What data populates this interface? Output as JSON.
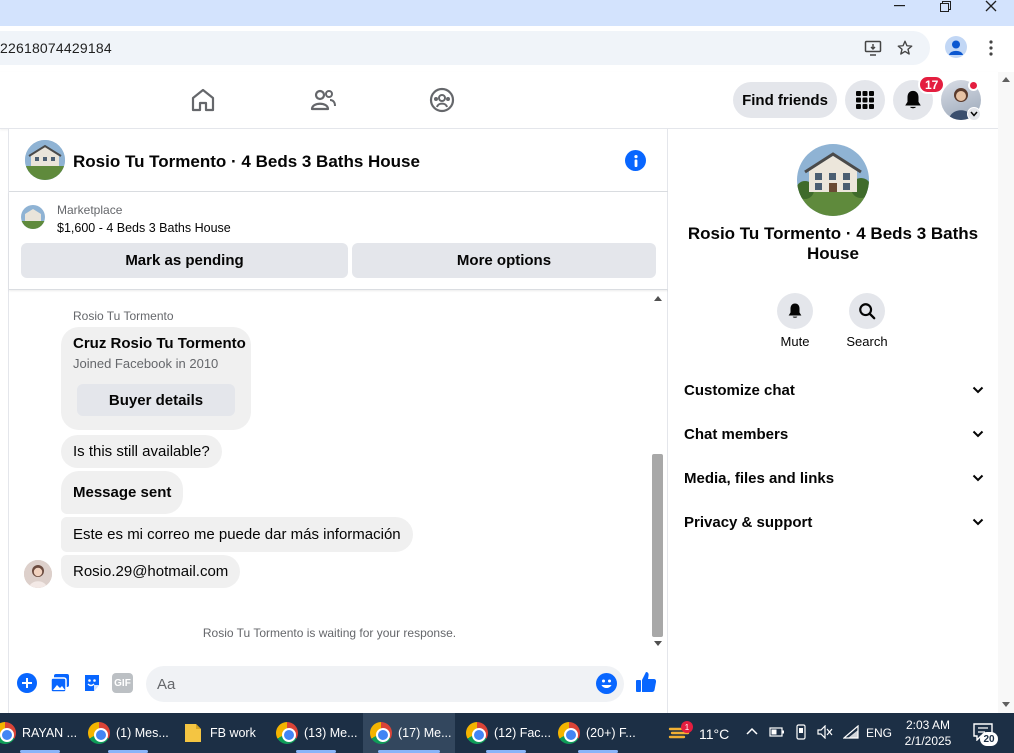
{
  "browser": {
    "url": "22618074429184"
  },
  "header": {
    "find_friends": "Find friends",
    "notification_count": "17"
  },
  "chat": {
    "title": "Rosio Tu Tormento · 4 Beds 3 Baths House",
    "marketplace_label": "Marketplace",
    "listing": "$1,600 - 4 Beds 3 Baths House",
    "mark_pending": "Mark as pending",
    "more_options": "More options",
    "sender_name": "Rosio Tu Tormento",
    "profile_card": {
      "name": "Cruz Rosio Tu Tormento",
      "joined": "Joined Facebook in 2010",
      "buyer_details": "Buyer details"
    },
    "messages": [
      "Is this still available?",
      "Message sent",
      "Este es mi correo me puede dar más información",
      "Rosio.29@hotmail.com"
    ],
    "waiting": "Rosio Tu Tormento is waiting for your response.",
    "composer_placeholder": "Aa"
  },
  "info_panel": {
    "title": "Rosio Tu Tormento · 4 Beds 3 Baths House",
    "mute": "Mute",
    "search": "Search",
    "sections": [
      "Customize chat",
      "Chat members",
      "Media, files and links",
      "Privacy & support"
    ]
  },
  "taskbar": {
    "items": [
      "RAYAN ...",
      "(1) Mes...",
      "FB work",
      "(13) Me...",
      "(17) Me...",
      "(12) Fac...",
      "(20+) F..."
    ],
    "weather_badge": "1",
    "temperature": "11°C",
    "language": "ENG",
    "time": "2:03 AM",
    "date": "2/1/2025",
    "notification_count": "20"
  },
  "colors": {
    "accent": "#0866ff",
    "badge": "#e41e3f",
    "taskbar": "#1c2f45"
  }
}
